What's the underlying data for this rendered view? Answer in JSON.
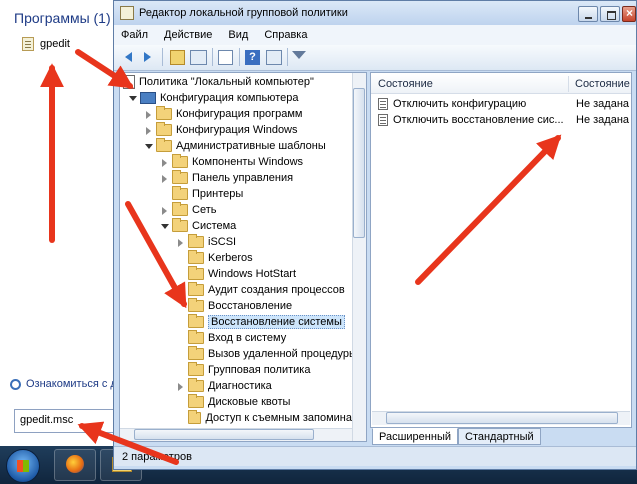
{
  "start_menu": {
    "programs_title": "Программы (1)",
    "program_item": "gpedit",
    "more_results": "Ознакомиться с д",
    "search_value": "gpedit.msc"
  },
  "window": {
    "title": "Редактор локальной групповой политики"
  },
  "menubar": {
    "items": [
      "Файл",
      "Действие",
      "Вид",
      "Справка"
    ]
  },
  "toolbar": {
    "help_glyph": "?"
  },
  "tree": {
    "items": [
      "Политика \"Локальный компьютер\"",
      "Конфигурация компьютера",
      "Конфигурация программ",
      "Конфигурация Windows",
      "Административные шаблоны",
      "Компоненты Windows",
      "Панель управления",
      "Принтеры",
      "Сеть",
      "Система",
      "iSCSI",
      "Kerberos",
      "Windows HotStart",
      "Аудит создания процессов",
      "Восстановление",
      "Восстановление системы",
      "Вход в систему",
      "Вызов удаленной процедуры",
      "Групповая политика",
      "Диагностика",
      "Дисковые квоты",
      "Доступ к съемным запомина"
    ]
  },
  "list": {
    "col_name": "Состояние",
    "col_state": "Состояние",
    "rows": [
      {
        "name": "Отключить конфигурацию",
        "state": "Не задана"
      },
      {
        "name": "Отключить восстановление сис...",
        "state": "Не задана"
      }
    ]
  },
  "tabs": {
    "extended": "Расширенный",
    "standard": "Стандартный"
  },
  "status": {
    "text": "2 параметров"
  },
  "colors": {
    "arrow": "#e8351c",
    "folder": "#f3d27a",
    "selection": "#cde5fb",
    "title_text": "#1e3b86"
  }
}
